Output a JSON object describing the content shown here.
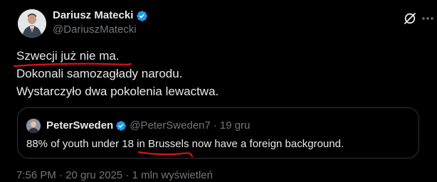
{
  "post": {
    "author": {
      "name": "Dariusz Matecki",
      "handle": "@DariuszMatecki",
      "verified_color": "#1d9bf0",
      "avatar_icon": "profile-photo"
    },
    "text_lines": [
      "Szwecji już nie ma.",
      "Dokonali samozagłady narodu.",
      "Wystarczyło dwa pokolenia lewactwa."
    ],
    "quote": {
      "author_name": "PeterSweden",
      "handle": "@PeterSweden7",
      "separator": "·",
      "time": "19 gru",
      "text": "88% of youth under 18 in Brussels now have a foreign background."
    },
    "footer_peek": "7:56 PM · 20 gru 2025 · 1 mln wyświetleń"
  },
  "icons": {
    "grok": "grok-icon",
    "more": "more-options-icon",
    "verified": "verified-badge-icon"
  },
  "annotation_color": "#e0101a"
}
